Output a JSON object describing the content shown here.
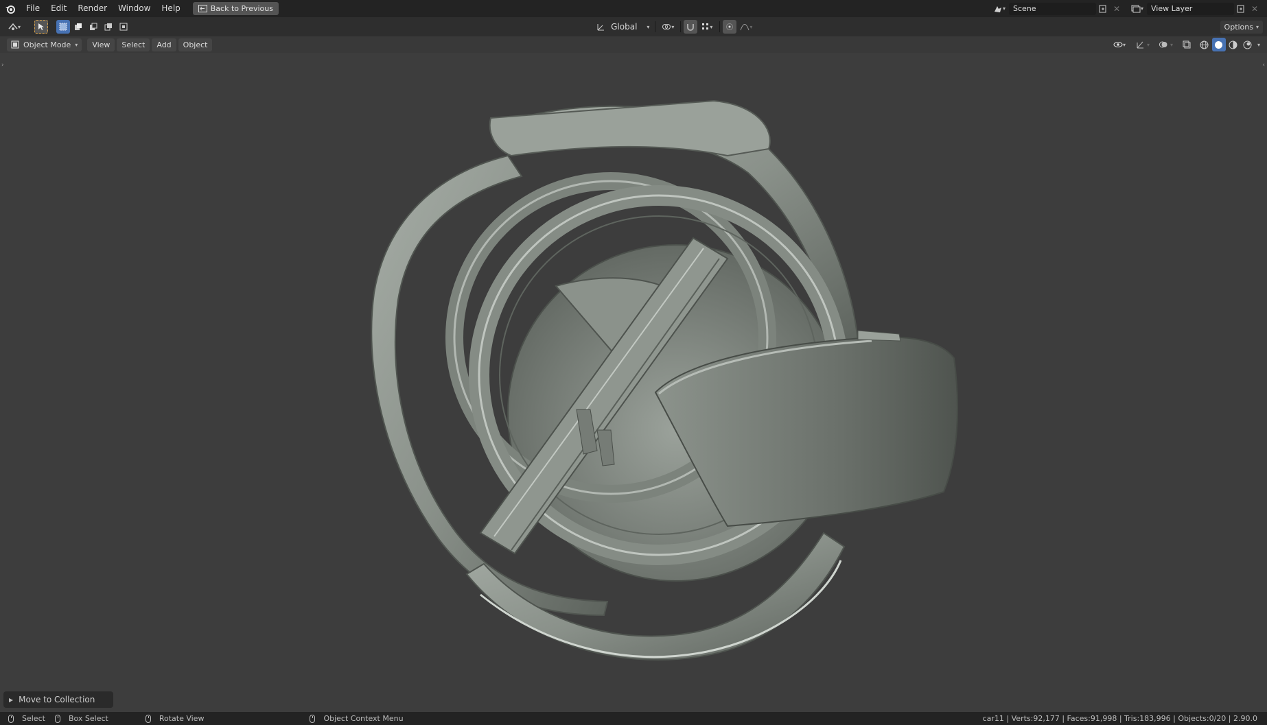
{
  "topbar": {
    "menus": [
      "File",
      "Edit",
      "Render",
      "Window",
      "Help"
    ],
    "back_button": "Back to Previous",
    "scene_name": "Scene",
    "view_layer": "View Layer"
  },
  "toolbar": {
    "transform_orientation": "Global",
    "options_label": "Options"
  },
  "header": {
    "mode": "Object Mode",
    "menus": [
      "View",
      "Select",
      "Add",
      "Object"
    ]
  },
  "operator_panel": {
    "label": "Move to Collection"
  },
  "statusbar": {
    "select": "Select",
    "box_select": "Box Select",
    "rotate_view": "Rotate View",
    "context_menu": "Object Context Menu",
    "stats": "car11 | Verts:92,177 | Faces:91,998 | Tris:183,996 | Objects:0/20 | 2.90.0"
  },
  "colors": {
    "accent": "#4772b3",
    "viewport_bg": "#3d3d3d",
    "model_base": "#8e958e"
  }
}
